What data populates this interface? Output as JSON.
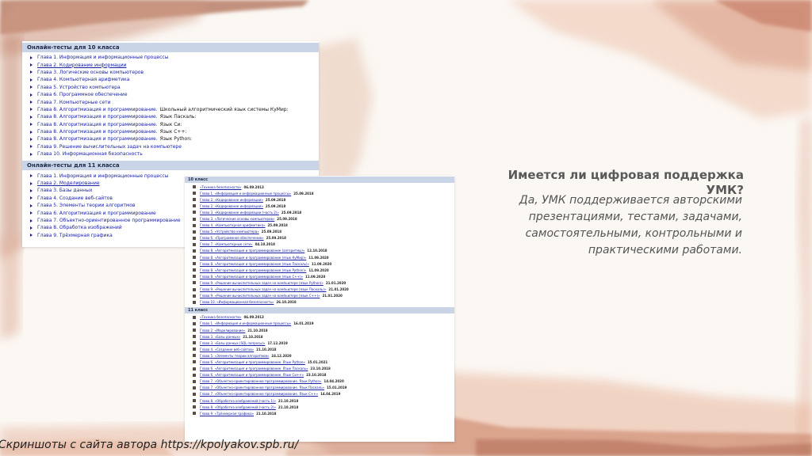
{
  "slide": {
    "heading": "Имеется ли цифровая поддержка УМК?",
    "body": "Да, УМК поддерживается авторскими презентациями, тестами, задачами, самостоятельными, контрольными и практическими работами.",
    "caption": "Скриншоты с сайта автора https://kpolyakov.spb.ru/"
  },
  "screenshot_a": {
    "section_10": {
      "title": "Онлайн-тесты для 10 класса",
      "items": [
        {
          "label": "Глава 1. Информация и информационные процессы",
          "suffix": ""
        },
        {
          "label": "Глава 2. Кодирование информации",
          "suffix": ""
        },
        {
          "label": "Глава 3. Логические основы компьютеров",
          "suffix": ""
        },
        {
          "label": "Глава 4. Компьютерная арифметика",
          "suffix": ""
        },
        {
          "label": "Глава 5. Устройство компьютера",
          "suffix": ""
        },
        {
          "label": "Глава 6. Программное обеспечение",
          "suffix": ""
        },
        {
          "label": "Глава 7. Компьютерные сети",
          "suffix": ""
        },
        {
          "label": "Глава 8. Алгоритмизация и программирование.",
          "suffix": "Школьный алгоритмический язык системы КуМир:"
        },
        {
          "label": "Глава 8. Алгоритмизация и программирование.",
          "suffix": "Язык Паскаль:"
        },
        {
          "label": "Глава 8. Алгоритмизация и программирование.",
          "suffix": "Язык Си:"
        },
        {
          "label": "Глава 8. Алгоритмизация и программирование.",
          "suffix": "Язык С++:"
        },
        {
          "label": "Глава 8. Алгоритмизация и программирование.",
          "suffix": "Язык Python:"
        },
        {
          "label": "Глава 9. Решение вычислительных задач на компьютере",
          "suffix": ""
        },
        {
          "label": "Глава 10. Информационная безопасность",
          "suffix": ""
        }
      ]
    },
    "section_11": {
      "title": "Онлайн-тесты для 11 класса",
      "items": [
        {
          "label": "Глава 1. Информация и информационные процессы"
        },
        {
          "label": "Глава 2. Моделирование"
        },
        {
          "label": "Глава 3. Базы данных"
        },
        {
          "label": "Глава 4. Создание веб-сайтов"
        },
        {
          "label": "Глава 5. Элементы теории алгоритмов"
        },
        {
          "label": "Глава 6. Алгоритмизация и программирование"
        },
        {
          "label": "Глава 7. Объектно-ориентированное программирование"
        },
        {
          "label": "Глава 8. Обработка изображений"
        },
        {
          "label": "Глава 9. Трёхмерная графика"
        }
      ]
    }
  },
  "screenshot_b": {
    "section_10": {
      "title": "10 класс",
      "items": [
        {
          "label": "«Техника безопасности»",
          "date": "06.09.2013"
        },
        {
          "label": "Глава 1. «Информация и информационные процессы»",
          "date": "25.09.2018"
        },
        {
          "label": "Глава 2. «Кодирование информации»",
          "date": "25.09.2018"
        },
        {
          "label": "Глава 2. «Кодирование информации»",
          "date": "25.09.2018"
        },
        {
          "label": "Глава 3. «Кодирование информации (часть 2)»",
          "date": "25.09.2018"
        },
        {
          "label": "Глава 3. «Логические основы компьютеров»",
          "date": "25.09.2018"
        },
        {
          "label": "Глава 4. «Компьютерная арифметика»",
          "date": "25.09.2018"
        },
        {
          "label": "Глава 5. «Устройство компьютера»",
          "date": "25.09.2018"
        },
        {
          "label": "Глава 6. «Программное обеспечение»",
          "date": "25.09.2018"
        },
        {
          "label": "Глава 7. «Компьютерные сети»",
          "date": "04.10.2018"
        },
        {
          "label": "Глава 8. «Алгоритмизация и программирование (алгоритмы)»",
          "date": "12.10.2018"
        },
        {
          "label": "Глава 8. «Алгоритмизация и программирование (язык КуМир)»",
          "date": "11.09.2020"
        },
        {
          "label": "Глава 8. «Алгоритмизация и программирование (язык Паскаль)»",
          "date": "11.09.2020"
        },
        {
          "label": "Глава 8. «Алгоритмизация и программирование (язык Python)»",
          "date": "11.09.2020"
        },
        {
          "label": "Глава 8. «Алгоритмизация и программирование (язык С++)»",
          "date": "11.09.2020"
        },
        {
          "label": "Глава 9. «Решение вычислительных задач на компьютере (язык Python)»",
          "date": "21.01.2020"
        },
        {
          "label": "Глава 9. «Решение вычислительных задач на компьютере (язык Паскаль)»",
          "date": "21.01.2020"
        },
        {
          "label": "Глава 9. «Решение вычислительных задач на компьютере (язык С++)»",
          "date": "21.01.2020"
        },
        {
          "label": "Глава 10. «Информационная безопасность»",
          "date": "26.10.2018"
        }
      ]
    },
    "section_11": {
      "title": "11 класс",
      "items": [
        {
          "label": "«Техника безопасности»",
          "date": "06.09.2013"
        },
        {
          "label": "Глава 1. «Информация и информационные процессы»",
          "date": "16.01.2019"
        },
        {
          "label": "Глава 2. «Моделирование»",
          "date": "21.10.2018"
        },
        {
          "label": "Глава 3. «Базы данных»",
          "date": "21.10.2018"
        },
        {
          "label": "Глава 3. «Базы данных (SQL-запросы)»",
          "date": "17.12.2019"
        },
        {
          "label": "Глава 4. «Создание веб-сайтов»",
          "date": "21.10.2018"
        },
        {
          "label": "Глава 5. «Элементы теории алгоритмов»",
          "date": "24.12.2020"
        },
        {
          "label": "Глава 6. «Алгоритмизация и программирование. Язык Python»",
          "date": "15.01.2021"
        },
        {
          "label": "Глава 6. «Алгоритмизация и программирование. Язык Паскаль»",
          "date": "23.10.2018"
        },
        {
          "label": "Глава 6. «Алгоритмизация и программирование. Язык Си++»",
          "date": "23.10.2018"
        },
        {
          "label": "Глава 7. «Объектно-ориентированное программирование. Язык Python»",
          "date": "14.04.2020"
        },
        {
          "label": "Глава 7. «Объектно-ориентированное программирование. Язык Паскаль»",
          "date": "15.01.2019"
        },
        {
          "label": "Глава 7. «Объектно-ориентированное программирование. Язык С++»",
          "date": "14.04.2019"
        },
        {
          "label": "Глава 8. «Обработка изображений (часть 1)»",
          "date": "21.10.2018"
        },
        {
          "label": "Глава 8. «Обработка изображений (часть 2)»",
          "date": "21.10.2018"
        },
        {
          "label": "Глава 9. «Трёхмерная графика»",
          "date": "21.10.2018"
        }
      ]
    }
  },
  "colors": {
    "slide_bg": "#fbf7f3",
    "heading": "#595959",
    "link": "#1a22a3",
    "section_header_bg": "#c9d5e6",
    "watercolor_dark": "#b3705c",
    "watercolor_mid": "#d8a28a",
    "watercolor_light": "#eecdbb"
  }
}
